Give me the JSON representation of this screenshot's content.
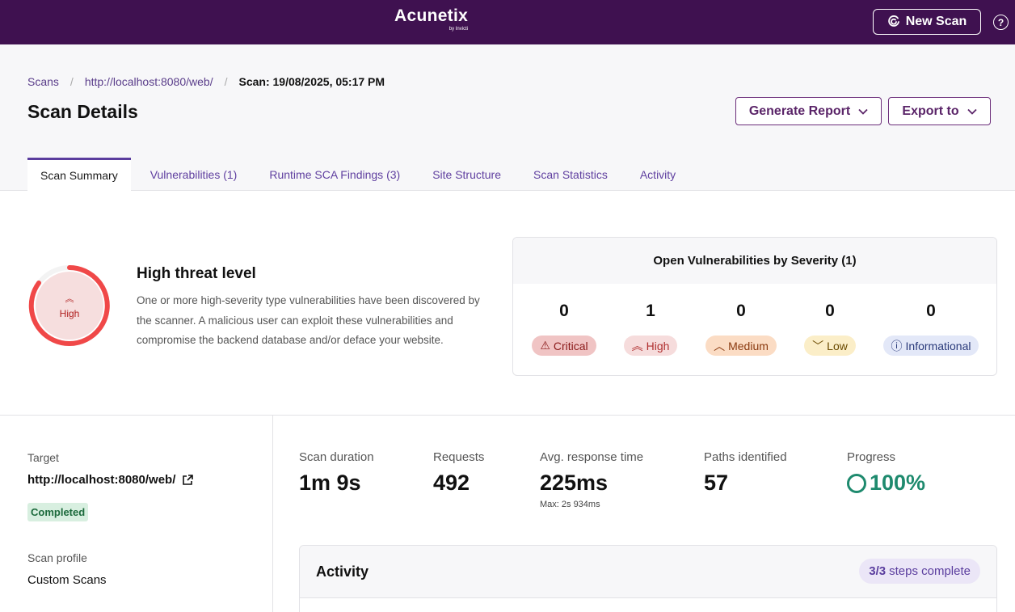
{
  "topbar": {
    "logo_name": "Acunetix",
    "logo_by": "by Invicti",
    "new_scan_label": "New Scan",
    "help_icon": "?"
  },
  "breadcrumb": {
    "items": [
      "Scans",
      "http://localhost:8080/web/"
    ],
    "current": "Scan: 19/08/2025, 05:17 PM",
    "separator": "/"
  },
  "header": {
    "title": "Scan Details",
    "generate_report_label": "Generate Report",
    "export_to_label": "Export to"
  },
  "tabs": [
    {
      "label": "Scan Summary",
      "active": true
    },
    {
      "label": "Vulnerabilities (1)",
      "active": false
    },
    {
      "label": "Runtime SCA Findings (3)",
      "active": false
    },
    {
      "label": "Site Structure",
      "active": false
    },
    {
      "label": "Scan Statistics",
      "active": false
    },
    {
      "label": "Activity",
      "active": false
    }
  ],
  "threat": {
    "level_label": "High",
    "title": "High threat level",
    "description": "One or more high-severity type vulnerabilities have been discovered by the scanner. A malicious user can exploit these vulnerabilities and compromise the backend database and/or deface your website.",
    "color": "#f04848"
  },
  "severity": {
    "title": "Open Vulnerabilities by Severity (1)",
    "items": [
      {
        "label": "Critical",
        "count": "0",
        "icon": "warning-triangle-icon",
        "glyph": "⚠",
        "bg": "#f0c4c4",
        "fg": "#8a1a1a"
      },
      {
        "label": "High",
        "count": "1",
        "icon": "double-chevron-up-icon",
        "glyph": "︽",
        "bg": "#f6dcdc",
        "fg": "#b03030"
      },
      {
        "label": "Medium",
        "count": "0",
        "icon": "chevron-up-icon",
        "glyph": "︿",
        "bg": "#fbdcc4",
        "fg": "#8a3a10"
      },
      {
        "label": "Low",
        "count": "0",
        "icon": "chevron-down-icon",
        "glyph": "﹀",
        "bg": "#fbeec8",
        "fg": "#6a4a00"
      },
      {
        "label": "Informational",
        "count": "0",
        "icon": "info-circle-icon",
        "glyph": "ⓘ",
        "bg": "#e3e8f8",
        "fg": "#2a3a7a"
      }
    ]
  },
  "target": {
    "label": "Target",
    "url": "http://localhost:8080/web/",
    "status": "Completed",
    "profile_label": "Scan profile",
    "profile_value": "Custom Scans"
  },
  "stats": {
    "duration_label": "Scan duration",
    "duration_value": "1m 9s",
    "requests_label": "Requests",
    "requests_value": "492",
    "avg_label": "Avg. response time",
    "avg_value": "225ms",
    "avg_max": "Max: 2s 934ms",
    "paths_label": "Paths identified",
    "paths_value": "57",
    "progress_label": "Progress",
    "progress_value": "100%",
    "progress_fraction": 1.0
  },
  "activity": {
    "title": "Activity",
    "steps_done": "3/3",
    "steps_text": "steps complete"
  }
}
